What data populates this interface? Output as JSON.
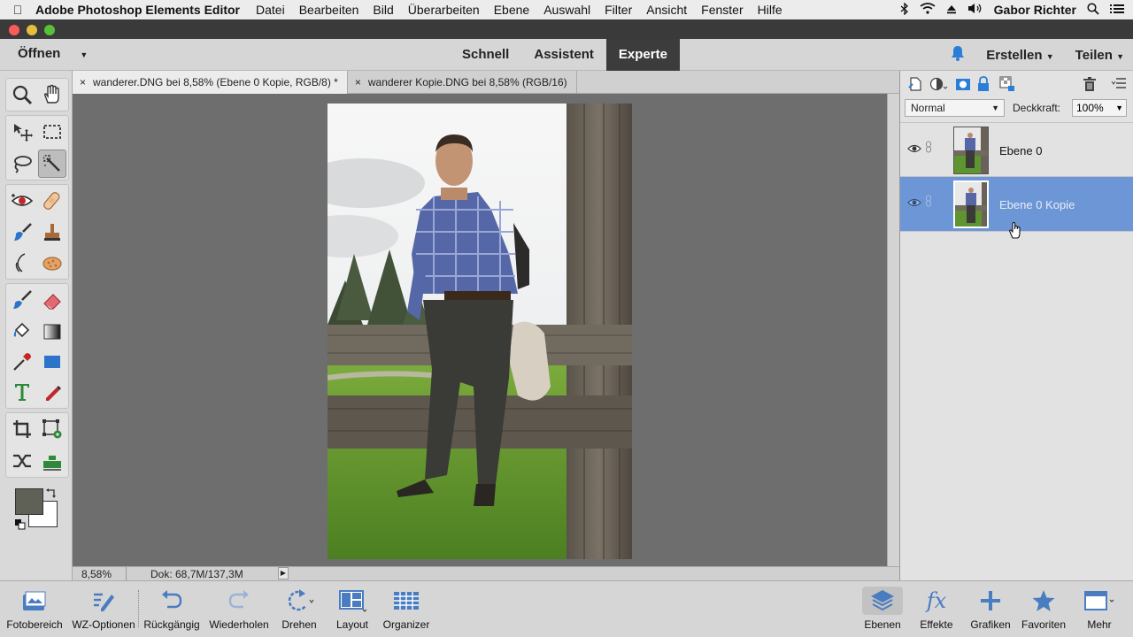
{
  "menubar": {
    "app_name": "Adobe Photoshop Elements Editor",
    "items": [
      "Datei",
      "Bearbeiten",
      "Bild",
      "Überarbeiten",
      "Ebene",
      "Auswahl",
      "Filter",
      "Ansicht",
      "Fenster",
      "Hilfe"
    ],
    "user": "Gabor Richter"
  },
  "modebar": {
    "open_label": "Öffnen",
    "tabs": [
      "Schnell",
      "Assistent",
      "Experte"
    ],
    "active_tab": "Experte",
    "create_label": "Erstellen",
    "share_label": "Teilen"
  },
  "doc_tabs": [
    "wanderer.DNG bei 8,58% (Ebene 0 Kopie, RGB/8) *",
    "wanderer Kopie.DNG bei 8,58% (RGB/16)"
  ],
  "status": {
    "zoom": "8,58%",
    "doc_size": "Dok: 68,7M/137,3M"
  },
  "layers_panel": {
    "blend_mode": "Normal",
    "opacity_label": "Deckkraft:",
    "opacity_value": "100%",
    "layers": [
      {
        "name": "Ebene 0",
        "selected": false
      },
      {
        "name": "Ebene 0 Kopie",
        "selected": true
      }
    ]
  },
  "bottombar": {
    "left": [
      "Fotobereich",
      "WZ-Optionen",
      "Rückgängig",
      "Wiederholen",
      "Drehen",
      "Layout",
      "Organizer"
    ],
    "right": [
      "Ebenen",
      "Effekte",
      "Grafiken",
      "Favoriten",
      "Mehr"
    ]
  },
  "colors": {
    "foreground_swatch": "#5f6156",
    "background_swatch": "#ffffff",
    "selection_blue": "#6d96d6",
    "accent_blue": "#2a7ed8"
  }
}
